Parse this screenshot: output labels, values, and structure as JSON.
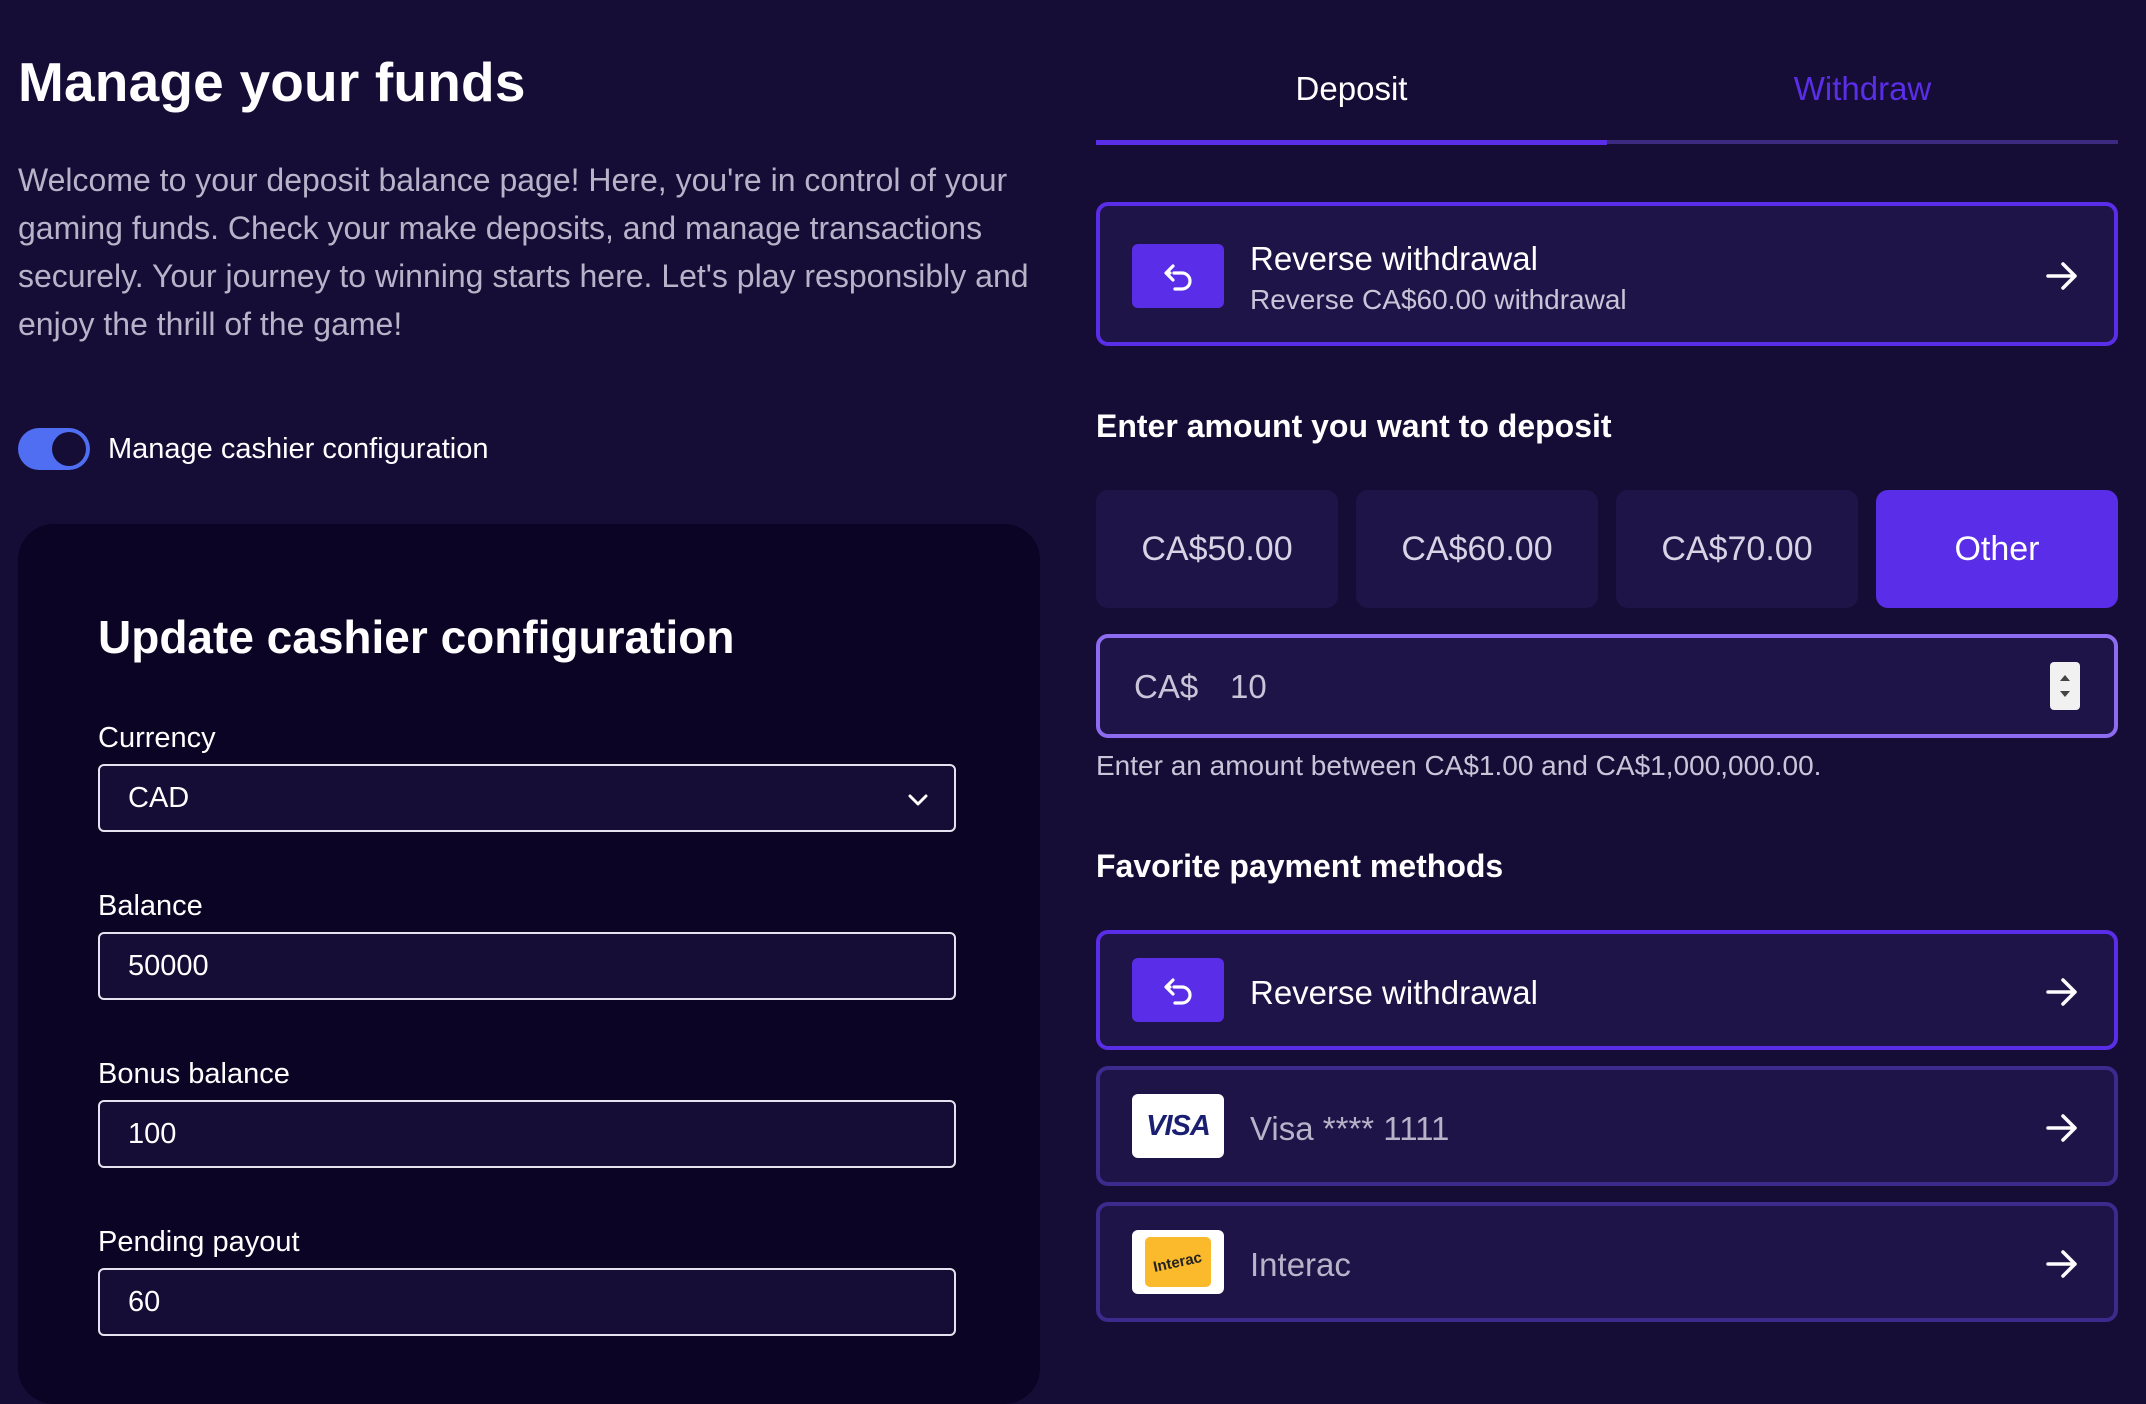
{
  "page": {
    "title": "Manage your funds",
    "intro": "Welcome to your deposit balance page! Here, you're in control of your gaming funds. Check your make deposits, and manage transactions securely. Your journey to winning starts here. Let's play responsibly and enjoy the thrill of the game!"
  },
  "toggle": {
    "label": "Manage cashier configuration",
    "on": true
  },
  "config": {
    "title": "Update cashier configuration",
    "fields": [
      {
        "label": "Currency",
        "value": "CAD",
        "type": "select"
      },
      {
        "label": "Balance",
        "value": "50000",
        "type": "input"
      },
      {
        "label": "Bonus balance",
        "value": "100",
        "type": "input"
      },
      {
        "label": "Pending payout",
        "value": "60",
        "type": "input"
      }
    ]
  },
  "tabs": {
    "deposit": "Deposit",
    "withdraw": "Withdraw",
    "active": "deposit"
  },
  "reverse_banner": {
    "title": "Reverse withdrawal",
    "subtitle": "Reverse CA$60.00 withdrawal",
    "icon": "reverse-icon"
  },
  "deposit": {
    "heading": "Enter amount you want to deposit",
    "amounts": [
      "CA$50.00",
      "CA$60.00",
      "CA$70.00",
      "Other"
    ],
    "selected": "Other",
    "currency_prefix": "CA$",
    "value": "10",
    "helper": "Enter an amount between CA$1.00 and CA$1,000,000.00."
  },
  "favorites": {
    "heading": "Favorite payment methods",
    "items": [
      {
        "label": "Reverse withdrawal",
        "icon": "reverse-icon"
      },
      {
        "label": "Visa **** 1111",
        "icon": "visa-logo",
        "logo_text": "VISA"
      },
      {
        "label": "Interac",
        "icon": "interac-logo",
        "logo_text": "Interac"
      }
    ]
  },
  "colors": {
    "background": "#150d35",
    "card": "#0b0424",
    "accent": "#5a2de8",
    "toggle": "#4f6ef2",
    "panel": "#1f1448"
  }
}
